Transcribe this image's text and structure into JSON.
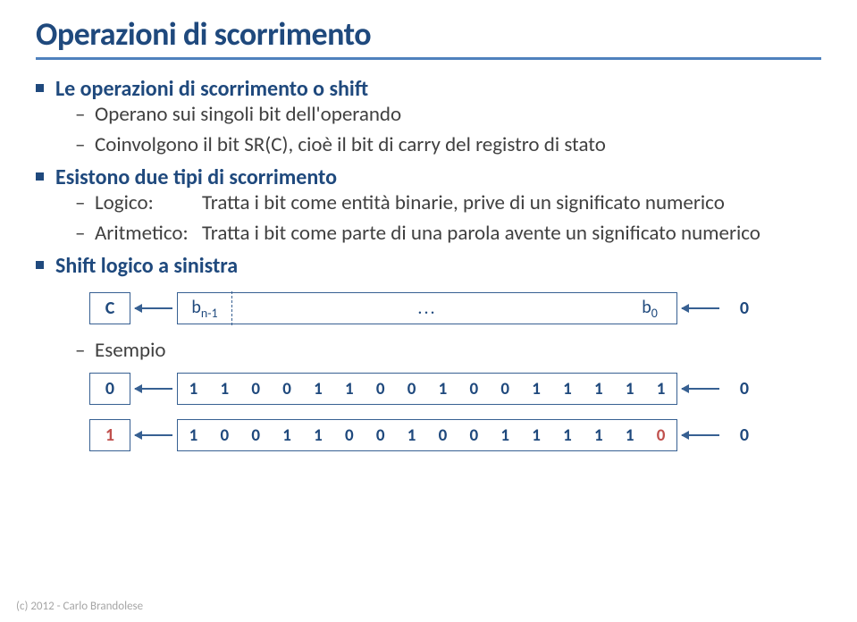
{
  "title": "Operazioni di scorrimento",
  "b1": {
    "heading": "Le operazioni di scorrimento o shift",
    "i1": "Operano sui singoli bit dell'operando",
    "i2": "Coinvolgono il bit SR(C), cioè il bit di carry del registro di stato"
  },
  "b2": {
    "heading": "Esistono due tipi di scorrimento",
    "logico_k": "Logico:",
    "logico_v": "Tratta i bit come entità binarie, prive di un significato numerico",
    "arit_k": "Aritmetico:",
    "arit_v": "Tratta i bit come parte di una parola avente un significato numerico"
  },
  "b3": {
    "heading": "Shift logico a sinistra"
  },
  "diagram": {
    "c_label": "C",
    "bn1": "b",
    "bn1_sub": "n-1",
    "dots": "...",
    "b0": "b",
    "b0_sub": "0",
    "zero": "0"
  },
  "esempio": "Esempio",
  "ex1": {
    "c": "0",
    "bits": [
      "1",
      "1",
      "0",
      "0",
      "1",
      "1",
      "0",
      "0",
      "1",
      "0",
      "0",
      "1",
      "1",
      "1",
      "1",
      "1"
    ],
    "in": "0"
  },
  "ex2": {
    "c": "1",
    "bits": [
      "1",
      "0",
      "0",
      "1",
      "1",
      "0",
      "0",
      "1",
      "0",
      "0",
      "1",
      "1",
      "1",
      "1",
      "1",
      "0"
    ],
    "in": "0"
  },
  "footer": "(c) 2012 - Carlo Brandolese",
  "chart_data": {
    "type": "table",
    "title": "Shift logico a sinistra - Esempio",
    "registers": [
      {
        "carry": 0,
        "bits": [
          1,
          1,
          0,
          0,
          1,
          1,
          0,
          0,
          1,
          0,
          0,
          1,
          1,
          1,
          1,
          1
        ],
        "input": 0
      },
      {
        "carry": 1,
        "bits": [
          1,
          0,
          0,
          1,
          1,
          0,
          0,
          1,
          0,
          0,
          1,
          1,
          1,
          1,
          1,
          0
        ],
        "input": 0
      }
    ],
    "shifted_in_index": 15,
    "shifted_out_c_second_row": true
  }
}
